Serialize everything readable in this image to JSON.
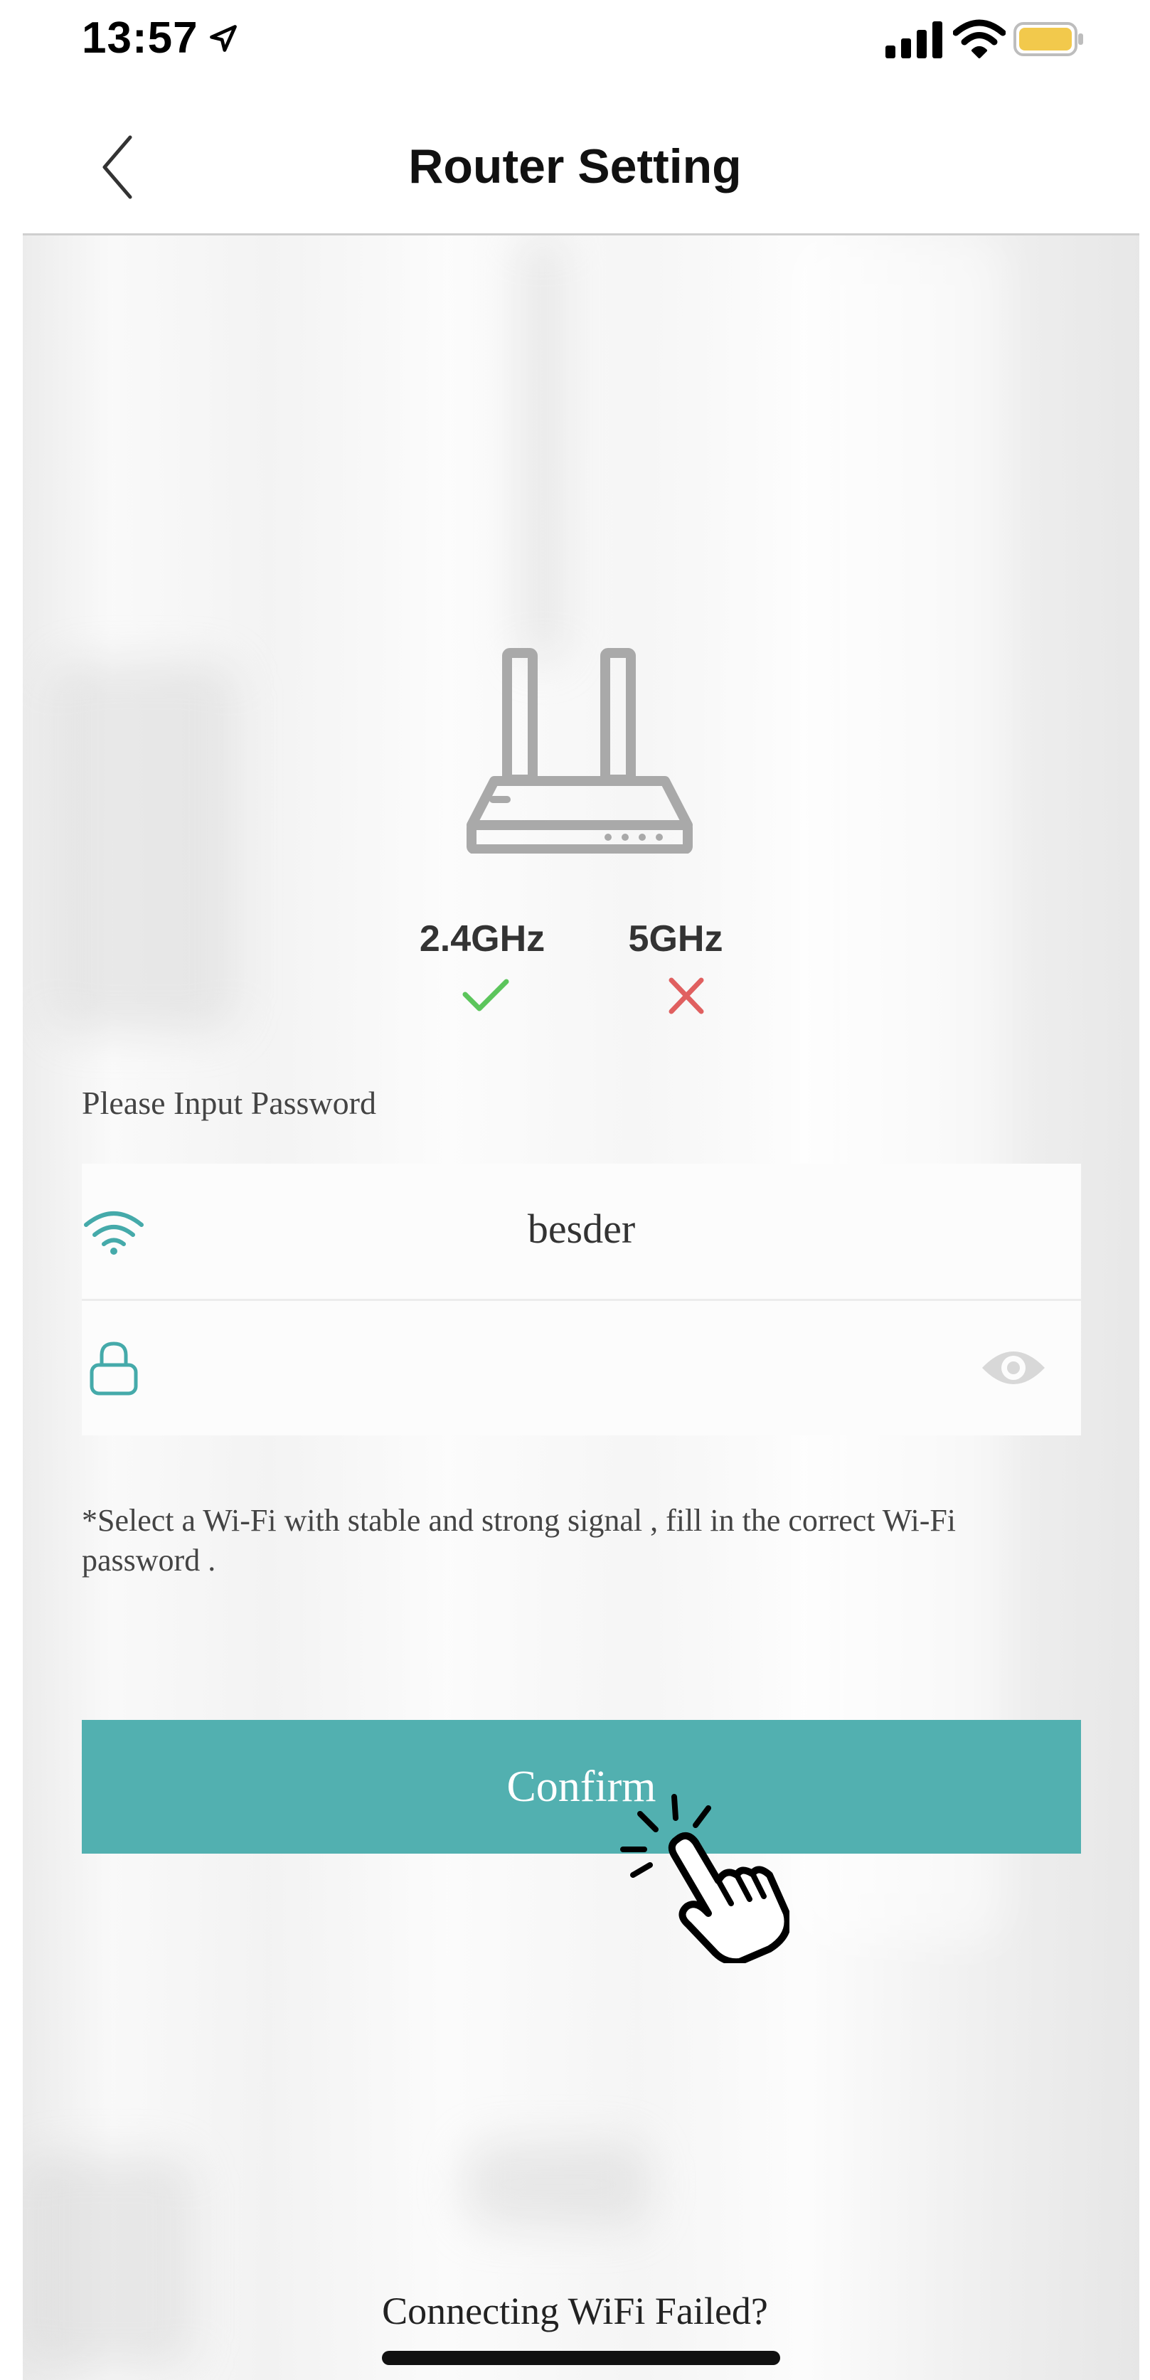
{
  "status_bar": {
    "time": "13:57",
    "icons": [
      "location-arrow-icon",
      "cellular-signal-icon",
      "wifi-icon",
      "battery-icon"
    ],
    "battery_color": "#f2c94c"
  },
  "header": {
    "title": "Router Setting",
    "back_icon": "chevron-left-icon"
  },
  "router": {
    "icon": "router-icon",
    "bands": [
      {
        "label": "2.4GHz",
        "status": "supported",
        "status_icon": "check-icon",
        "color": "#5cc55c"
      },
      {
        "label": "5GHz",
        "status": "unsupported",
        "status_icon": "cross-icon",
        "color": "#e06060"
      }
    ]
  },
  "form": {
    "label": "Please Input Password",
    "ssid": {
      "icon": "wifi-icon",
      "value": "besder",
      "icon_color": "#45aaaa"
    },
    "password": {
      "icon": "lock-icon",
      "value": "",
      "placeholder": "",
      "toggle_icon": "eye-icon"
    },
    "hint": "*Select a Wi-Fi with stable and strong signal , fill in the correct Wi-Fi password ."
  },
  "confirm_button": {
    "label": "Confirm",
    "color": "#52b0b0",
    "overlay_icon": "pointer-hand-icon"
  },
  "footer": {
    "help_link": "Connecting WiFi Failed?"
  }
}
